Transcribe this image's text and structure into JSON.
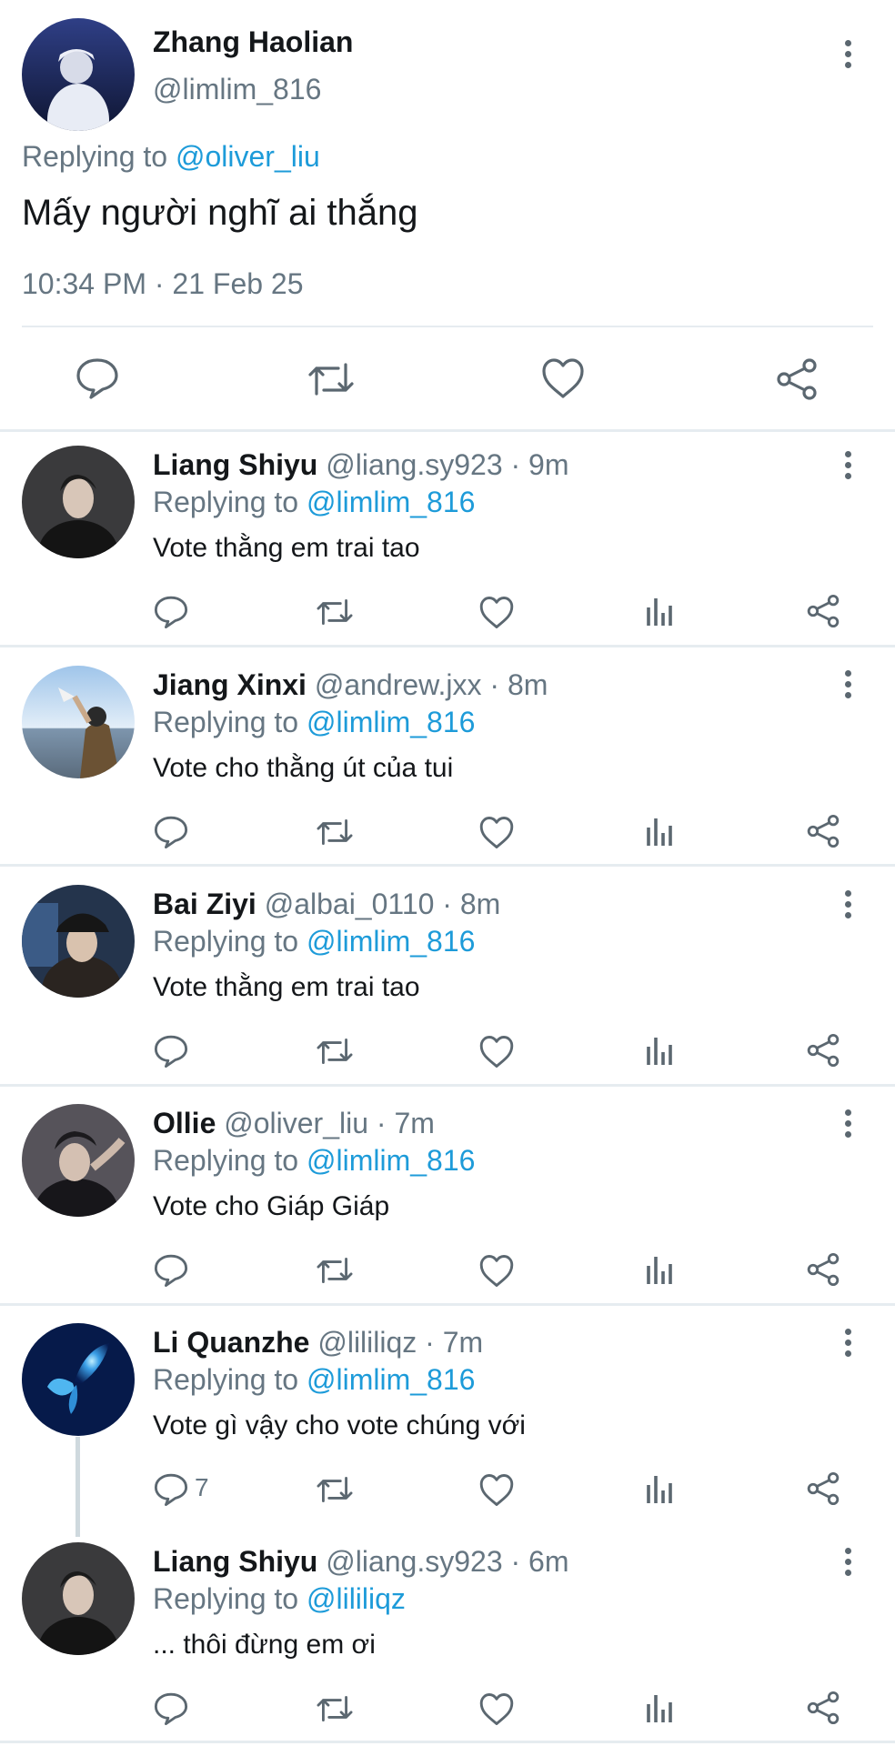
{
  "main_tweet": {
    "display_name": "Zhang Haolian",
    "handle": "@limlim_816",
    "replying_prefix": "Replying to",
    "replying_to": "@oliver_liu",
    "text": "Mấy người nghĩ ai thắng",
    "timestamp": "10:34 PM · 21 Feb 25"
  },
  "replies": [
    {
      "name": "Liang Shiyu",
      "meta": "@liang.sy923 · 9m",
      "replying_prefix": "Replying to",
      "replying_to": "@limlim_816",
      "text": "Vote thằng em trai tao",
      "reply_count": ""
    },
    {
      "name": "Jiang Xinxi",
      "meta": "@andrew.jxx · 8m",
      "replying_prefix": "Replying to",
      "replying_to": "@limlim_816",
      "text": "Vote cho thằng út của tui",
      "reply_count": ""
    },
    {
      "name": "Bai Ziyi",
      "meta": "@albai_0110 · 8m",
      "replying_prefix": "Replying to",
      "replying_to": "@limlim_816",
      "text": "Vote thằng em trai tao",
      "reply_count": ""
    },
    {
      "name": "Ollie",
      "meta": "@oliver_liu · 7m",
      "replying_prefix": "Replying to",
      "replying_to": "@limlim_816",
      "text": "Vote cho Giáp Giáp",
      "reply_count": ""
    },
    {
      "name": "Li Quanzhe",
      "meta": "@lililiqz · 7m",
      "replying_prefix": "Replying to",
      "replying_to": "@limlim_816",
      "text": "Vote gì vậy cho vote chúng với",
      "reply_count": "7"
    },
    {
      "name": "Liang Shiyu",
      "meta": "@liang.sy923 · 6m",
      "replying_prefix": "Replying to",
      "replying_to": "@lililiqz",
      "text": "... thôi đừng em ơi",
      "reply_count": ""
    }
  ],
  "icons": {
    "reply": "reply-bubble-icon",
    "retweet": "retweet-icon",
    "like": "heart-icon",
    "stats": "analytics-bars-icon",
    "share": "share-icon",
    "more": "more-vertical-icon"
  },
  "colors": {
    "accent": "#1d9bd9",
    "icon_grey": "#5b6770",
    "divider": "#e6ecf0"
  }
}
